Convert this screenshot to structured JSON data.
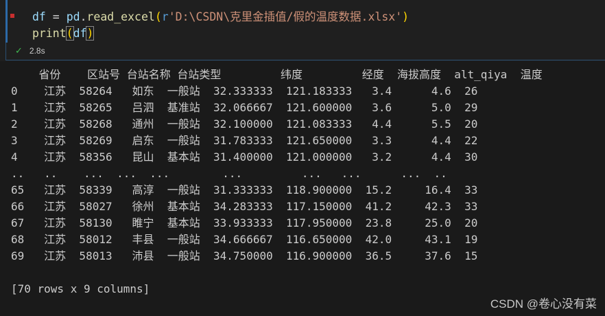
{
  "cell": {
    "code": {
      "line1": {
        "var": "df",
        "op": " = ",
        "module": "pd",
        "dot": ".",
        "fn": "read_excel",
        "open": "(",
        "prefix": "r",
        "string": "'D:\\CSDN\\克里金插值/假的温度数据.xlsx'",
        "close": ")"
      },
      "line2": {
        "fn": "print",
        "open": "(",
        "arg": "df",
        "close": ")"
      }
    },
    "status": {
      "check": "✓",
      "duration": "2.8s"
    }
  },
  "output": {
    "header": "    省份    区站号 台站名称 台站类型         纬度         经度  海拔高度  alt_qiya  温度",
    "rows": [
      "0    江苏  58264   如东  一般站  32.333333  121.183333   3.4      4.6  26",
      "1    江苏  58265   吕泗  基准站  32.066667  121.600000   3.6      5.0  29",
      "2    江苏  58268   通州  一般站  32.100000  121.083333   4.4      5.5  20",
      "3    江苏  58269   启东  一般站  31.783333  121.650000   3.3      4.4  22",
      "4    江苏  58356   昆山  基本站  31.400000  121.000000   3.2      4.4  30",
      "..   ..    ...  ...  ...        ...         ...   ...      ...  ..",
      "65   江苏  58339   高淳  一般站  31.333333  118.900000  15.2     16.4  33",
      "66   江苏  58027   徐州  基本站  34.283333  117.150000  41.2     42.3  33",
      "67   江苏  58130   睢宁  基本站  33.933333  117.950000  23.8     25.0  20",
      "68   江苏  58012   丰县  一般站  34.666667  116.650000  42.0     43.1  19",
      "69   江苏  58013   沛县  一般站  34.750000  116.900000  36.5     37.6  15"
    ],
    "summary": "[70 rows x 9 columns]"
  },
  "watermark": "CSDN @卷心没有菜",
  "colors": {
    "background": "#1f1f1f",
    "output_background": "#1a1a1a",
    "accent": "#2c6aa8",
    "success": "#3fb950"
  }
}
